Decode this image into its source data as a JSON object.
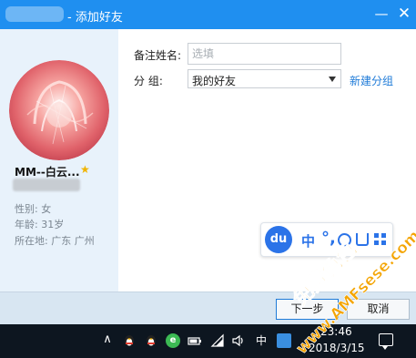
{
  "window": {
    "title": "- 添加好友",
    "minimize_glyph": "—",
    "close_glyph": "✕"
  },
  "profile": {
    "nickname": "MM--白云...",
    "gender": "性别: 女",
    "age": "年龄: 31岁",
    "location": "所在地: 广东  广州"
  },
  "form": {
    "remark_label": "备注姓名:",
    "remark_placeholder": "选填",
    "group_label": "分      组:",
    "group_value": "我的好友",
    "new_group_link": "新建分组"
  },
  "ime_toolbar": {
    "logo": "du",
    "mode": "中",
    "punctuation": "°,"
  },
  "footer": {
    "next_button": "下一步",
    "cancel_button": "取消"
  },
  "taskbar": {
    "time": "23:46",
    "date": "2018/3/15",
    "ime_indicator": "中"
  },
  "watermark": {
    "text": "免费色色",
    "url": "www.AMFsese.com"
  },
  "colors": {
    "titlebar": "#1f8ff0",
    "accent_link": "#1f7bd8",
    "profile_panel": "#e8f2fb",
    "watermark": "#f4a400"
  }
}
